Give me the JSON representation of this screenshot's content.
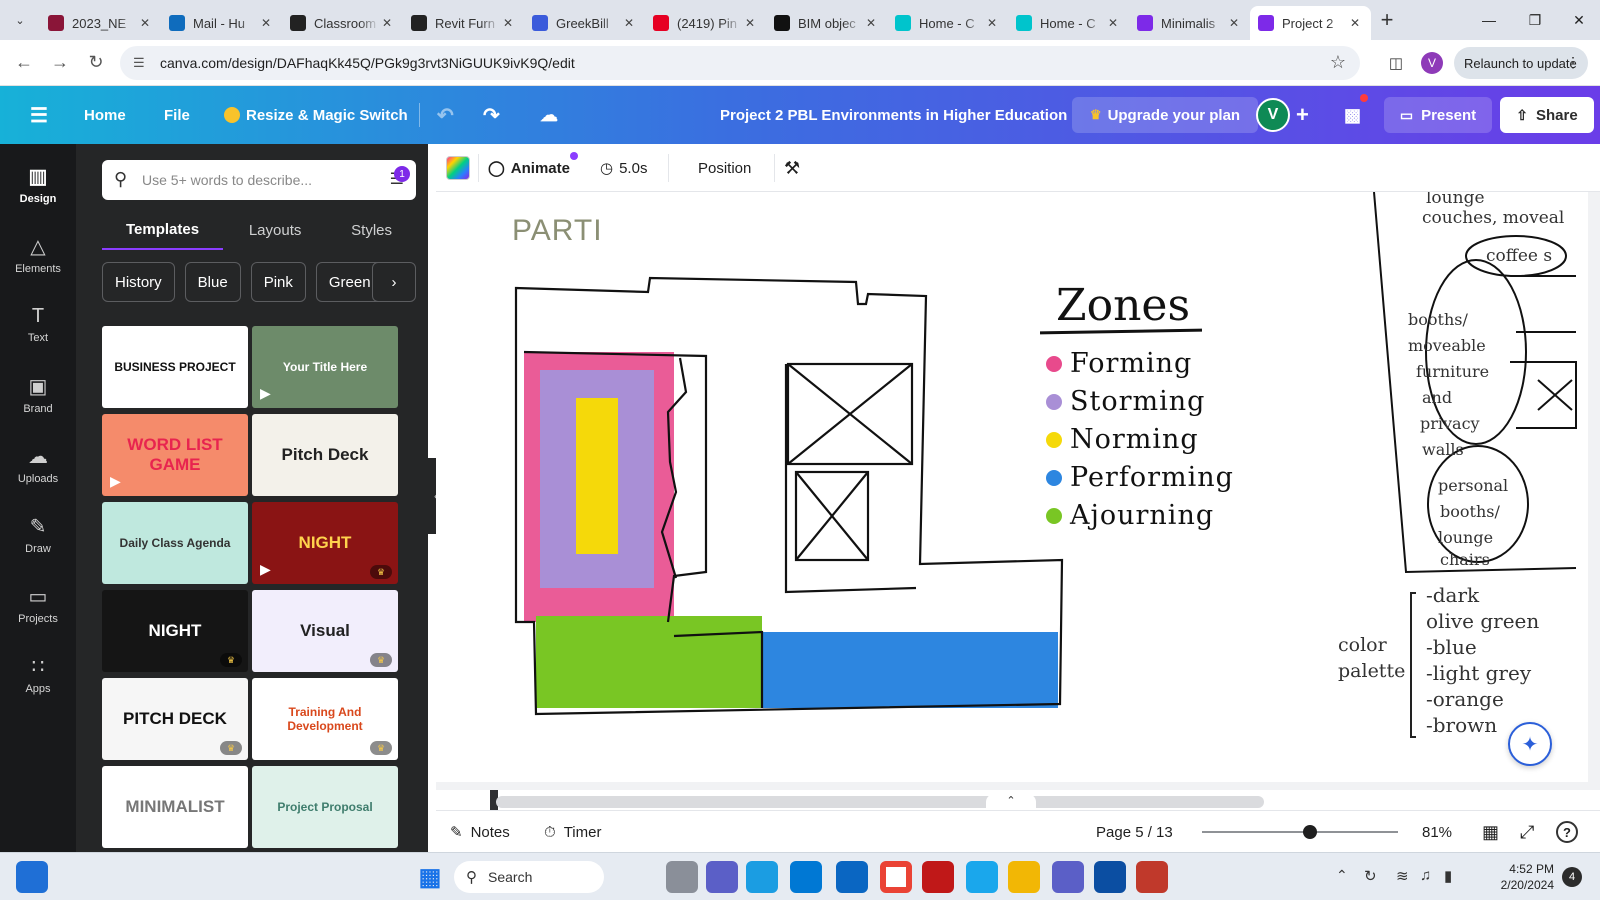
{
  "browser": {
    "tabs": [
      {
        "title": "2023_NE",
        "icon_color": "#8a1538",
        "icon": "university-icon"
      },
      {
        "title": "Mail - Hu",
        "icon_color": "#0f6cbd",
        "icon": "outlook-icon"
      },
      {
        "title": "Classroom",
        "icon_color": "#222222",
        "icon": "sc-icon"
      },
      {
        "title": "Revit Furn",
        "icon_color": "#222222",
        "icon": "sc-icon"
      },
      {
        "title": "GreekBill",
        "icon_color": "#3b5bdb",
        "icon": "greekbill-icon"
      },
      {
        "title": "(2419) Pin",
        "icon_color": "#e60023",
        "icon": "pinterest-icon"
      },
      {
        "title": "BIM objec",
        "icon_color": "#111111",
        "icon": "bim-icon"
      },
      {
        "title": "Home - C",
        "icon_color": "#00c4cc",
        "icon": "canva-icon"
      },
      {
        "title": "Home - C",
        "icon_color": "#00c4cc",
        "icon": "canva-icon"
      },
      {
        "title": "Minimalis",
        "icon_color": "#7d2ae8",
        "icon": "canva-icon"
      },
      {
        "title": "Project 2",
        "icon_color": "#7d2ae8",
        "icon": "canva-icon",
        "active": true
      }
    ],
    "url": "canva.com/design/DAFhaqKk45Q/PGk9g3rvt3NiGUUK9ivK9Q/edit",
    "profile_initial": "V",
    "relaunch_label": "Relaunch to update"
  },
  "canva": {
    "home_label": "Home",
    "file_label": "File",
    "magic_label": "Resize & Magic Switch",
    "doc_title": "Project 2 PBL Environments in Higher Education",
    "upgrade_label": "Upgrade your plan",
    "avatar_initial": "V",
    "present_label": "Present",
    "share_label": "Share"
  },
  "rail": [
    {
      "label": "Design",
      "icon": "design-icon",
      "active": true
    },
    {
      "label": "Elements",
      "icon": "elements-icon"
    },
    {
      "label": "Text",
      "icon": "text-icon"
    },
    {
      "label": "Brand",
      "icon": "brand-icon"
    },
    {
      "label": "Uploads",
      "icon": "uploads-icon"
    },
    {
      "label": "Draw",
      "icon": "draw-icon"
    },
    {
      "label": "Projects",
      "icon": "projects-icon"
    },
    {
      "label": "Apps",
      "icon": "apps-icon"
    }
  ],
  "panel": {
    "search_placeholder": "Use 5+ words to describe...",
    "filter_badge": "1",
    "tabs": [
      "Templates",
      "Layouts",
      "Styles"
    ],
    "chips": [
      "History",
      "Blue",
      "Pink",
      "Green"
    ],
    "templates": [
      {
        "text": "BUSINESS PROJECT",
        "bg": "#ffffff",
        "fg": "#111111"
      },
      {
        "text": "Your Title Here",
        "bg": "#6d8b6a",
        "fg": "#ffffff",
        "video": true
      },
      {
        "text": "WORD LIST GAME",
        "bg": "#f58b6b",
        "fg": "#e8244f",
        "video": true
      },
      {
        "text": "Pitch Deck",
        "bg": "#f3f1ea",
        "fg": "#222222"
      },
      {
        "text": "Daily Class Agenda",
        "bg": "#bfe8de",
        "fg": "#333333"
      },
      {
        "text": "NIGHT",
        "bg": "#8a1414",
        "fg": "#ffd34d",
        "video": true,
        "premium": true
      },
      {
        "text": "NIGHT",
        "bg": "#151515",
        "fg": "#ffffff",
        "premium": true
      },
      {
        "text": "Visual",
        "bg": "#f2eefc",
        "fg": "#222222",
        "premium": true
      },
      {
        "text": "PITCH DECK",
        "bg": "#f6f6f6",
        "fg": "#111111",
        "premium": true
      },
      {
        "text": "Training And Development",
        "bg": "#ffffff",
        "fg": "#d9481c",
        "premium": true
      },
      {
        "text": "MINIMALIST",
        "bg": "#ffffff",
        "fg": "#777777"
      },
      {
        "text": "Project Proposal",
        "bg": "#dff1ea",
        "fg": "#3f7d6d"
      }
    ]
  },
  "editor": {
    "animate_label": "Animate",
    "duration_label": "5.0s",
    "position_label": "Position"
  },
  "slide": {
    "heading": "PARTI",
    "zones_title": "Zones",
    "zones": [
      {
        "label": "Forming",
        "color": "#e84a8c"
      },
      {
        "label": "Storming",
        "color": "#a98fd6"
      },
      {
        "label": "Norming",
        "color": "#f5d90a"
      },
      {
        "label": "Performing",
        "color": "#2d86e0"
      },
      {
        "label": "Ajourning",
        "color": "#79c624"
      }
    ],
    "notes_right": [
      "lounge",
      "couches, moveal",
      "coffee s",
      "booths/",
      "moveable",
      "furniture",
      "and",
      "privacy",
      "walls",
      "personal",
      "booths/",
      "lounge",
      "chairs"
    ],
    "palette_label": [
      "color",
      "palette"
    ],
    "palette": [
      "-dark",
      "olive green",
      "-blue",
      "-light grey",
      "-orange",
      "-brown"
    ]
  },
  "bottom": {
    "notes_label": "Notes",
    "timer_label": "Timer",
    "page_label": "Page 5 / 13",
    "zoom_label": "81%",
    "zoom_level": 0.55
  },
  "taskbar": {
    "search_label": "Search",
    "time": "4:52 PM",
    "date": "2/20/2024",
    "notif_count": "4"
  }
}
